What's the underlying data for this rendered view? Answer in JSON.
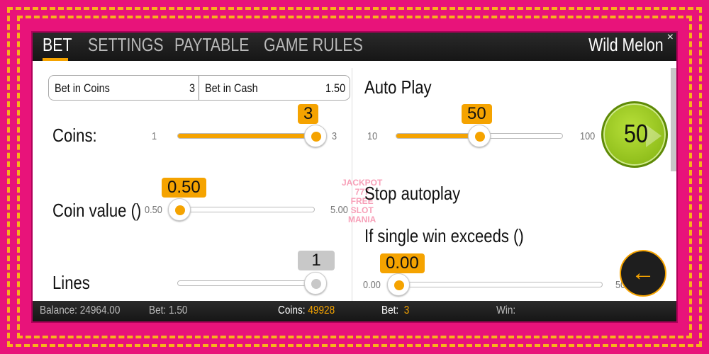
{
  "tabs": [
    {
      "label": "BET"
    },
    {
      "label": "SETTINGS"
    },
    {
      "label": "PAYTABLE"
    },
    {
      "label": "GAME RULES"
    }
  ],
  "title": "Wild Melon",
  "close_icon": "×",
  "bet_box": {
    "coins_label": "Bet in Coins",
    "coins_value": "3",
    "cash_label": "Bet in Cash",
    "cash_value": "1.50"
  },
  "coins": {
    "label": "Coins:",
    "min": "1",
    "max": "3",
    "value": "3",
    "fraction": 1
  },
  "coin_value": {
    "label": "Coin value ()",
    "min": "0.50",
    "max": "5.00",
    "value": "0.50",
    "fraction": 0
  },
  "lines": {
    "label": "Lines",
    "value": "1",
    "fraction": 1
  },
  "auto_play": {
    "label": "Auto Play",
    "min": "10",
    "max": "100",
    "value": "50",
    "fraction": 0.44,
    "button": "50"
  },
  "stop_autoplay": {
    "label": "Stop autoplay",
    "single_win_label": "If single win exceeds ()",
    "min": "0.00",
    "max": "50",
    "value": "0.00",
    "fraction": 0
  },
  "back_icon": "←",
  "footer": {
    "balance_label": "Balance:",
    "balance": "24964.00",
    "bet_label": "Bet:",
    "bet": "1.50",
    "coins_label": "Coins:",
    "coins": "49928",
    "bet2_label": "Bet:",
    "bet2": "3",
    "win_label": "Win:"
  },
  "watermark": "JACKPOT 777 FREE SLOT MANIA",
  "colors": {
    "accent": "#f5a300",
    "frame": "#e8137a",
    "dash": "#f7b21c",
    "play": "#8fc21a"
  }
}
